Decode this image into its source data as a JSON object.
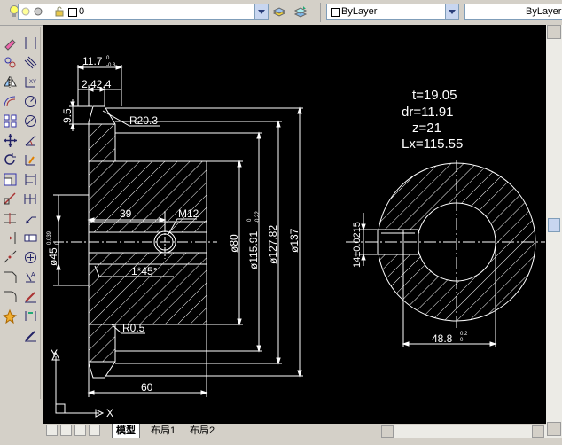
{
  "layer_toolbar": {
    "current_layer": "0",
    "color_combo": "ByLayer",
    "linetype_combo": "ByLayer"
  },
  "tabs": {
    "model": "模型",
    "layout1": "布局1",
    "layout2": "布局2"
  },
  "ucs": {
    "x": "X",
    "y": "Y"
  },
  "drawing": {
    "dim_11_7": "11.7",
    "dim_11_7_tol": "0",
    "dim_11_7_tol2": "-0.3",
    "dim_2_42_4": "2.42.4",
    "dim_9_5": "9.5",
    "dim_r20_3": "R20.3",
    "dim_39": "39",
    "dim_m12": "M12",
    "dim_d45": "ø45",
    "dim_d45_tol": "0.039",
    "dim_d45_tol2": "0",
    "dim_1x45": "1*45°",
    "dim_r0_5": "R0.5",
    "dim_60": "60",
    "dim_d80": "ø80",
    "dim_d115": "ø115.91",
    "dim_d115_tol": "0",
    "dim_d115_tol2": "-0.22",
    "dim_d127": "ø127.82",
    "dim_d137": "ø137",
    "param_t": "t=19.05",
    "param_dr": "dr=11.91",
    "param_z": "z=21",
    "param_lx": "Lx=115.55",
    "dim_14": "14±0.0215",
    "dim_48_8": "48.8",
    "dim_48_8_tol": "0.2",
    "dim_48_8_tol2": "0"
  },
  "colors": {
    "canvas": "#000000",
    "lines": "#ffffff",
    "toolbar": "#d4d0c8"
  }
}
